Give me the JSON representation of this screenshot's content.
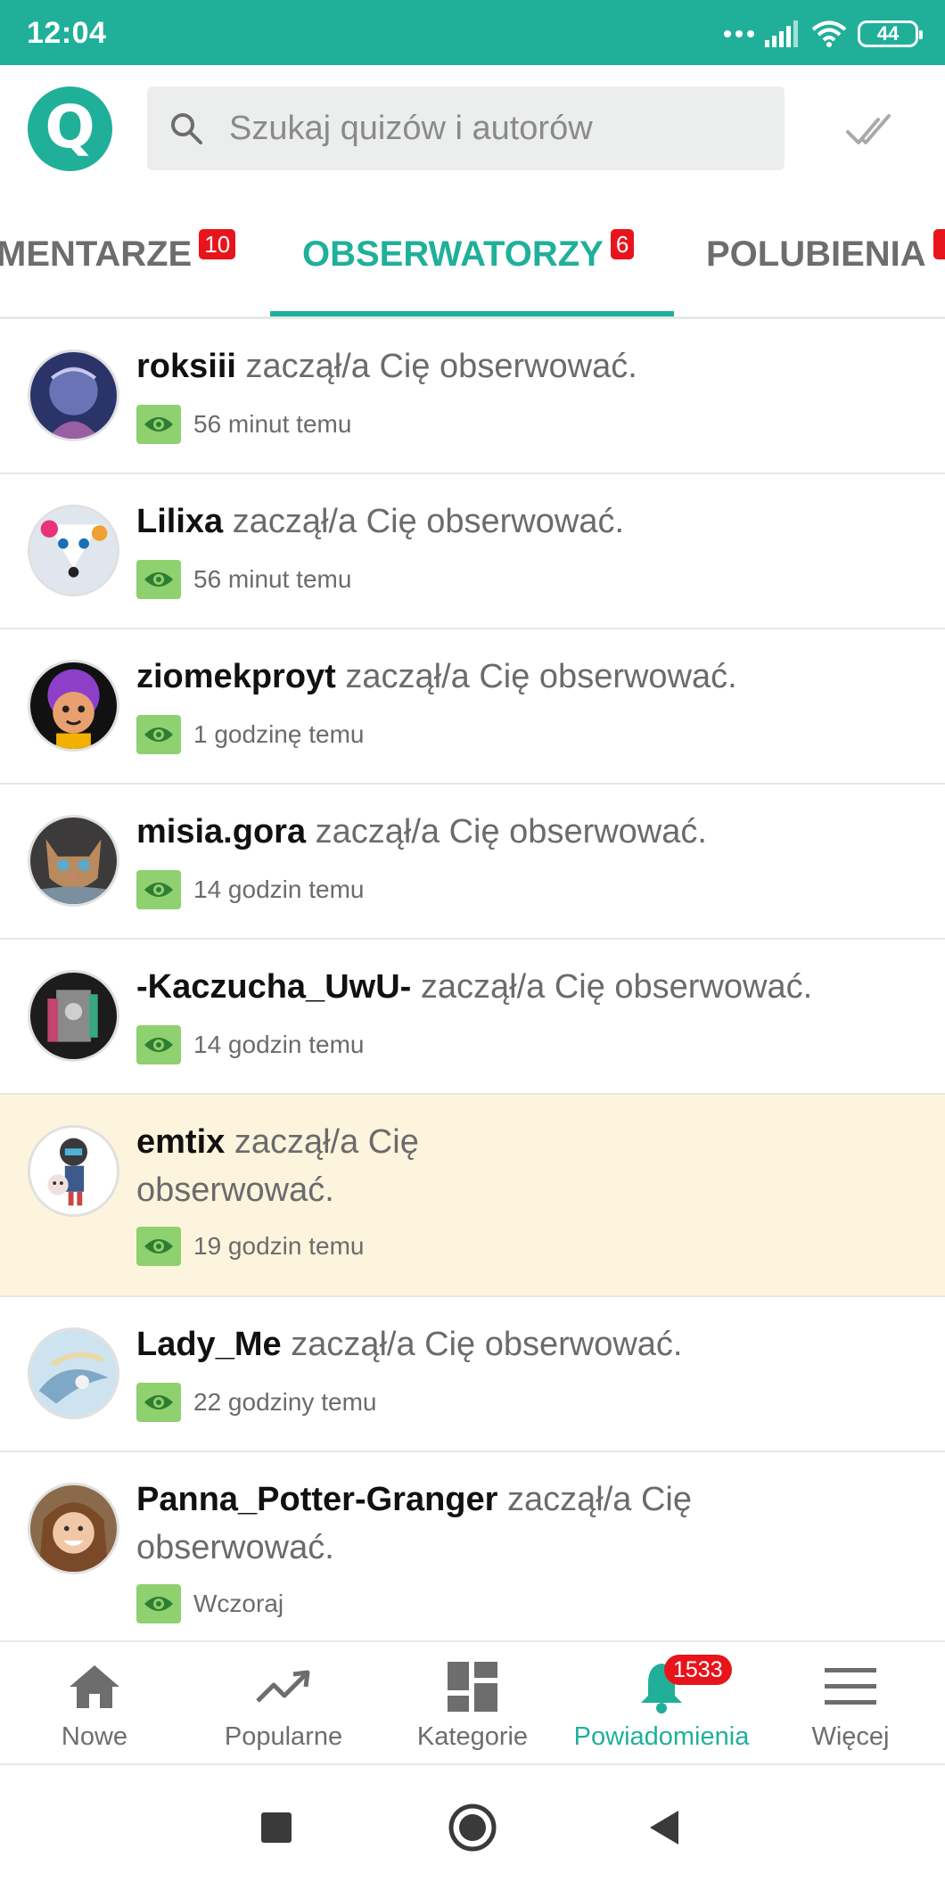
{
  "status": {
    "time": "12:04",
    "battery": "44"
  },
  "header": {
    "logo_letter": "Q",
    "search_placeholder": "Szukaj quizów i autorów"
  },
  "tabs": [
    {
      "label": "MENTARZE",
      "badge": "10",
      "active": false
    },
    {
      "label": "OBSERWATORZY",
      "badge": "6",
      "active": true
    },
    {
      "label": "POLUBIENIA",
      "badge": "",
      "active": false
    }
  ],
  "notifications": [
    {
      "username": "roksiii",
      "action": "zaczął/a Cię obserwować.",
      "time": "56 minut temu",
      "highlight": false
    },
    {
      "username": "Lilixa",
      "action": "zaczął/a Cię obserwować.",
      "time": "56 minut temu",
      "highlight": false
    },
    {
      "username": "ziomekproyt",
      "action": "zaczął/a Cię obserwować.",
      "time": "1 godzinę temu",
      "highlight": false
    },
    {
      "username": "misia.gora",
      "action": "zaczął/a Cię obserwować.",
      "time": "14 godzin temu",
      "highlight": false
    },
    {
      "username": "-Kaczucha_UwU-",
      "action": "zaczął/a Cię obserwować.",
      "time": "14 godzin temu",
      "highlight": false
    },
    {
      "username": "emtix",
      "action": "zaczął/a Cię",
      "action_line2": "obserwować.",
      "time": "19 godzin temu",
      "highlight": true
    },
    {
      "username": "Lady_Me",
      "action": "zaczął/a Cię obserwować.",
      "time": "22 godziny temu",
      "highlight": false
    },
    {
      "username": "Panna_Potter-Granger",
      "action": "zaczął/a Cię",
      "action_line2": "obserwować.",
      "time": "Wczoraj",
      "highlight": false
    }
  ],
  "bottom_nav": [
    {
      "label": "Nowe",
      "icon": "home-icon",
      "active": false
    },
    {
      "label": "Popularne",
      "icon": "trending-icon",
      "active": false
    },
    {
      "label": "Kategorie",
      "icon": "grid-icon",
      "active": false
    },
    {
      "label": "Powiadomienia",
      "icon": "bell-icon",
      "active": true,
      "badge": "1533"
    },
    {
      "label": "Więcej",
      "icon": "menu-icon",
      "active": false
    }
  ],
  "colors": {
    "accent": "#20b09a",
    "badge": "#e8141c",
    "eye_badge": "#8fd06f",
    "highlight_row": "#fdf4de"
  }
}
